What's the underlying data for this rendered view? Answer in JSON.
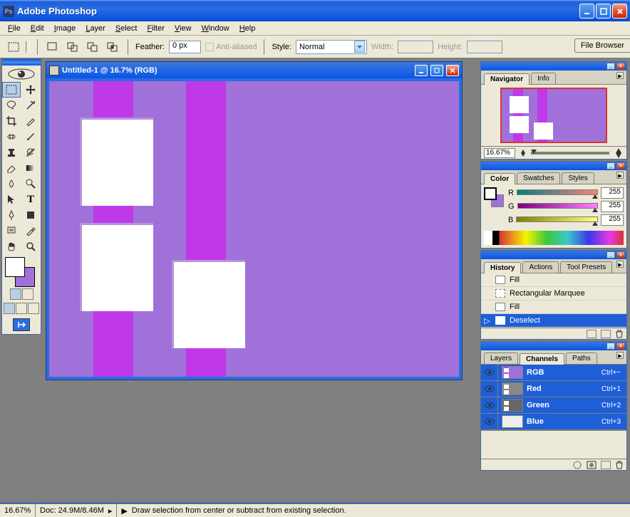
{
  "app": {
    "title": "Adobe Photoshop"
  },
  "menu": [
    "File",
    "Edit",
    "Image",
    "Layer",
    "Select",
    "Filter",
    "View",
    "Window",
    "Help"
  ],
  "options": {
    "feather_label": "Feather:",
    "feather_value": "0 px",
    "antialiased_label": "Anti-aliased",
    "style_label": "Style:",
    "style_value": "Normal",
    "width_label": "Width:",
    "height_label": "Height:",
    "file_browser": "File Browser"
  },
  "doc": {
    "title": "Untitled-1 @ 16.7% (RGB)"
  },
  "navigator": {
    "tabs": [
      "Navigator",
      "Info"
    ],
    "zoom": "16.67%"
  },
  "color": {
    "tabs": [
      "Color",
      "Swatches",
      "Styles"
    ],
    "r_label": "R",
    "g_label": "G",
    "b_label": "B",
    "r": "255",
    "g": "255",
    "b": "255"
  },
  "history": {
    "tabs": [
      "History",
      "Actions",
      "Tool Presets"
    ],
    "items": [
      {
        "label": "Fill"
      },
      {
        "label": "Rectangular Marquee"
      },
      {
        "label": "Fill"
      },
      {
        "label": "Deselect",
        "active": true
      }
    ]
  },
  "channels": {
    "tabs": [
      "Layers",
      "Channels",
      "Paths"
    ],
    "rows": [
      {
        "name": "RGB",
        "shortcut": "Ctrl+~",
        "thumb": "rgb"
      },
      {
        "name": "Red",
        "shortcut": "Ctrl+1",
        "thumb": "gray"
      },
      {
        "name": "Green",
        "shortcut": "Ctrl+2",
        "thumb": "gray"
      },
      {
        "name": "Blue",
        "shortcut": "Ctrl+3",
        "thumb": "white"
      }
    ]
  },
  "status": {
    "zoom": "16.67%",
    "doc": "Doc: 24.9M/8.46M",
    "hint": "Draw selection from center or subtract from existing selection."
  }
}
